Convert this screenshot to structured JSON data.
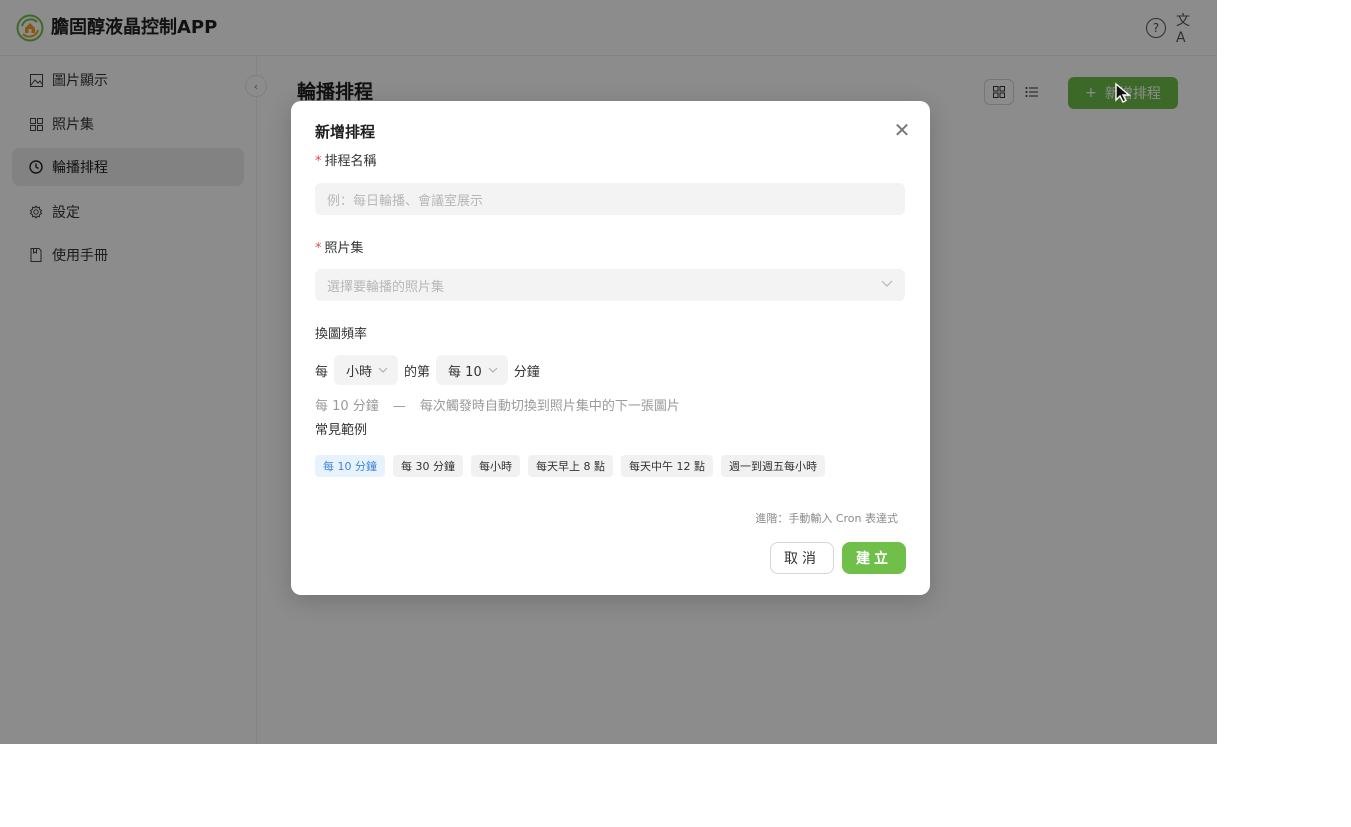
{
  "app": {
    "title": "膽固醇液晶控制APP"
  },
  "header": {
    "help_icon": "help-circle-icon",
    "lang_icon": "translate-icon",
    "help_glyph": "?",
    "lang_glyph": "文A"
  },
  "sidebar": {
    "items": [
      {
        "label": "圖片顯示",
        "icon": "image-icon",
        "active": false
      },
      {
        "label": "照片集",
        "icon": "grid-icon",
        "active": false
      },
      {
        "label": "輪播排程",
        "icon": "clock-icon",
        "active": true
      },
      {
        "label": "設定",
        "icon": "gear-icon",
        "active": false
      },
      {
        "label": "使用手冊",
        "icon": "book-icon",
        "active": false
      }
    ],
    "collapse_glyph": "‹"
  },
  "main": {
    "title": "輪播排程",
    "new_button_label": "新增排程",
    "new_button_glyph": "+"
  },
  "modal": {
    "title": "新增排程",
    "close_glyph": "✕",
    "name_field": {
      "label": "排程名稱",
      "required_mark": "*",
      "placeholder": "例：每日輪播、會議室展示"
    },
    "album_field": {
      "label": "照片集",
      "required_mark": "*",
      "placeholder": "選擇要輪播的照片集"
    },
    "frequency": {
      "label": "換圖頻率",
      "prefix": "每",
      "unit_value": "小時",
      "middle": "的第",
      "minute_value": "每 10",
      "suffix": "分鐘"
    },
    "hint": {
      "left": "每 10 分鐘",
      "dash": "—",
      "right": "每次觸發時自動切換到照片集中的下一張圖片"
    },
    "examples_label": "常見範例",
    "examples": [
      {
        "label": "每 10 分鐘",
        "active": true
      },
      {
        "label": "每 30 分鐘",
        "active": false
      },
      {
        "label": "每小時",
        "active": false
      },
      {
        "label": "每天早上 8 點",
        "active": false
      },
      {
        "label": "每天中午 12 點",
        "active": false
      },
      {
        "label": "週一到週五每小時",
        "active": false
      }
    ],
    "advanced_link": "進階：手動輸入 Cron 表達式",
    "cancel_label": "取消",
    "create_label": "建立"
  },
  "colors": {
    "accent": "#6fbf4a",
    "active_chip_text": "#3f86d6",
    "required": "#e5484d"
  }
}
